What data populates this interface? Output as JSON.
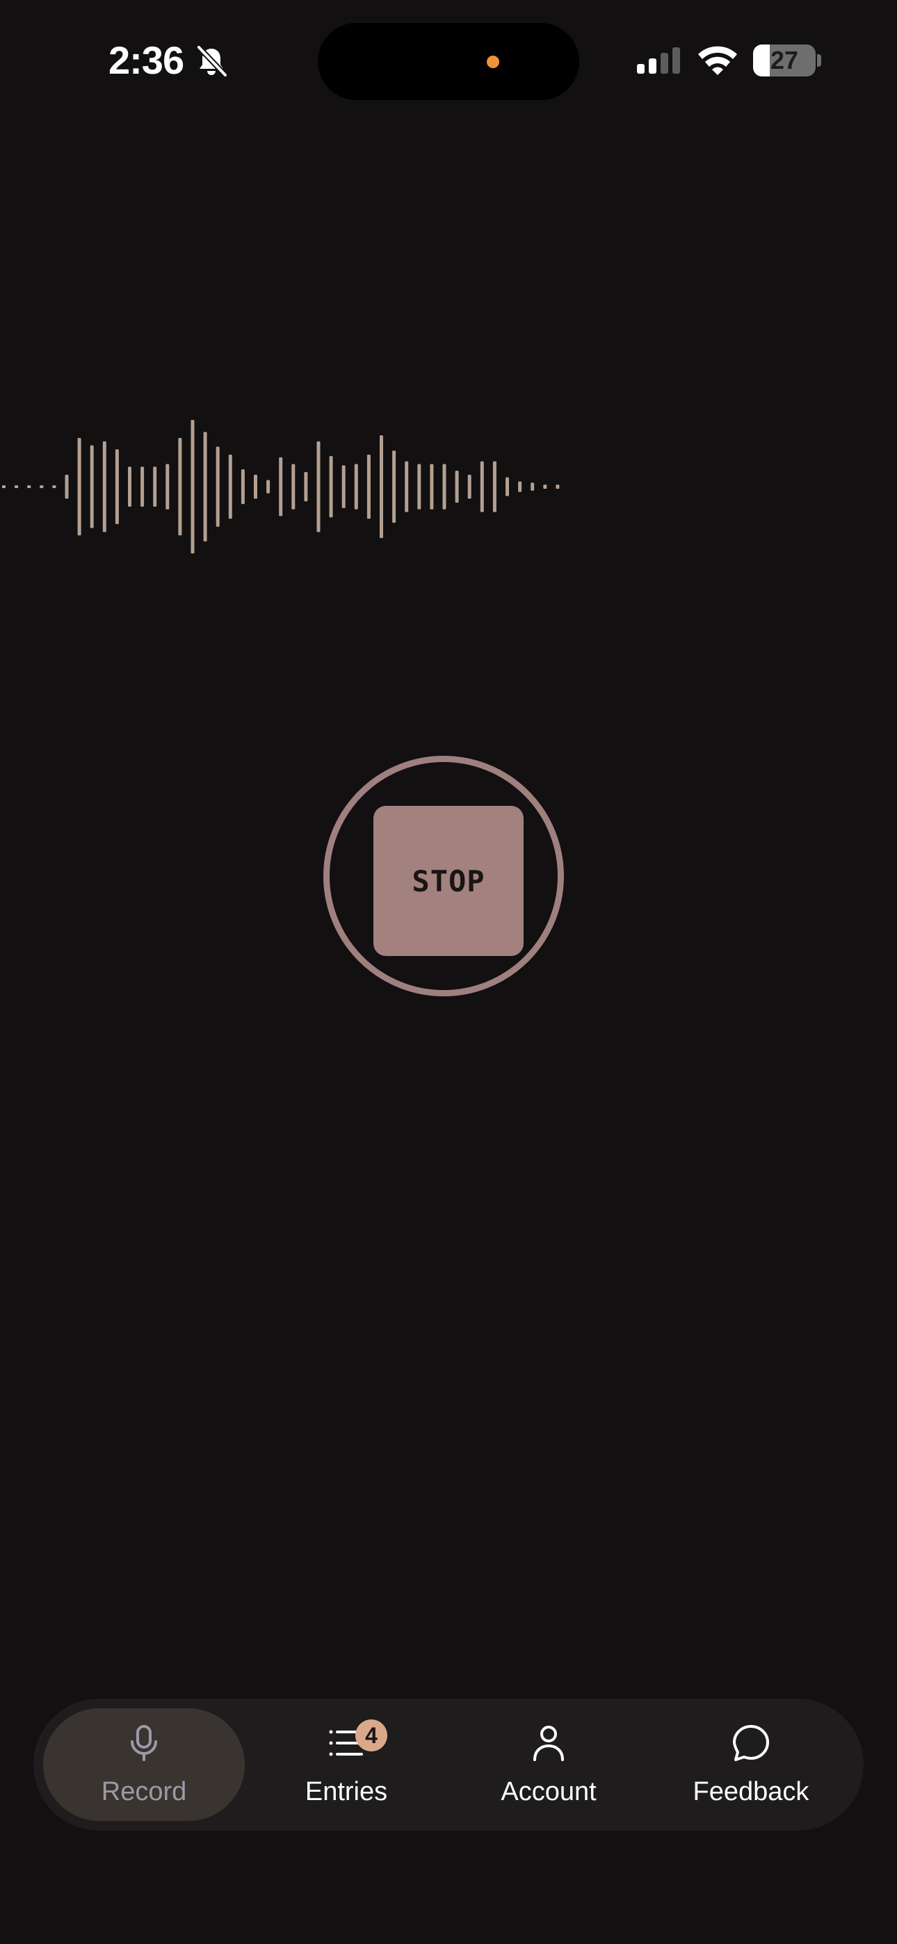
{
  "status_bar": {
    "time": "2:36",
    "battery_level": "27",
    "battery_fraction": 0.27,
    "silent_mode_icon": "bell-slash-icon",
    "signal_icon": "cellular-signal-icon",
    "wifi_icon": "wifi-icon",
    "privacy_indicator_color": "#f0913a"
  },
  "waveform": {
    "color": "#b3a092",
    "levels": [
      0.0,
      0.0,
      0.0,
      0.0,
      0.0,
      0.18,
      0.73,
      0.62,
      0.68,
      0.56,
      0.3,
      0.3,
      0.3,
      0.34,
      0.73,
      1.0,
      0.82,
      0.6,
      0.48,
      0.26,
      0.18,
      0.1,
      0.44,
      0.34,
      0.22,
      0.68,
      0.46,
      0.32,
      0.34,
      0.48,
      0.77,
      0.54,
      0.38,
      0.34,
      0.34,
      0.34,
      0.24,
      0.18,
      0.38,
      0.38,
      0.14,
      0.08,
      0.06,
      0.03,
      0.02
    ]
  },
  "recorder": {
    "stop_label": "STOP",
    "accent_color": "#a2817f"
  },
  "tab_bar": {
    "active_tab": "record",
    "tabs": [
      {
        "id": "record",
        "label": "Record",
        "icon": "microphone-icon"
      },
      {
        "id": "entries",
        "label": "Entries",
        "icon": "list-icon",
        "badge": "4"
      },
      {
        "id": "account",
        "label": "Account",
        "icon": "person-icon"
      },
      {
        "id": "feedback",
        "label": "Feedback",
        "icon": "chat-bubble-icon"
      }
    ]
  }
}
